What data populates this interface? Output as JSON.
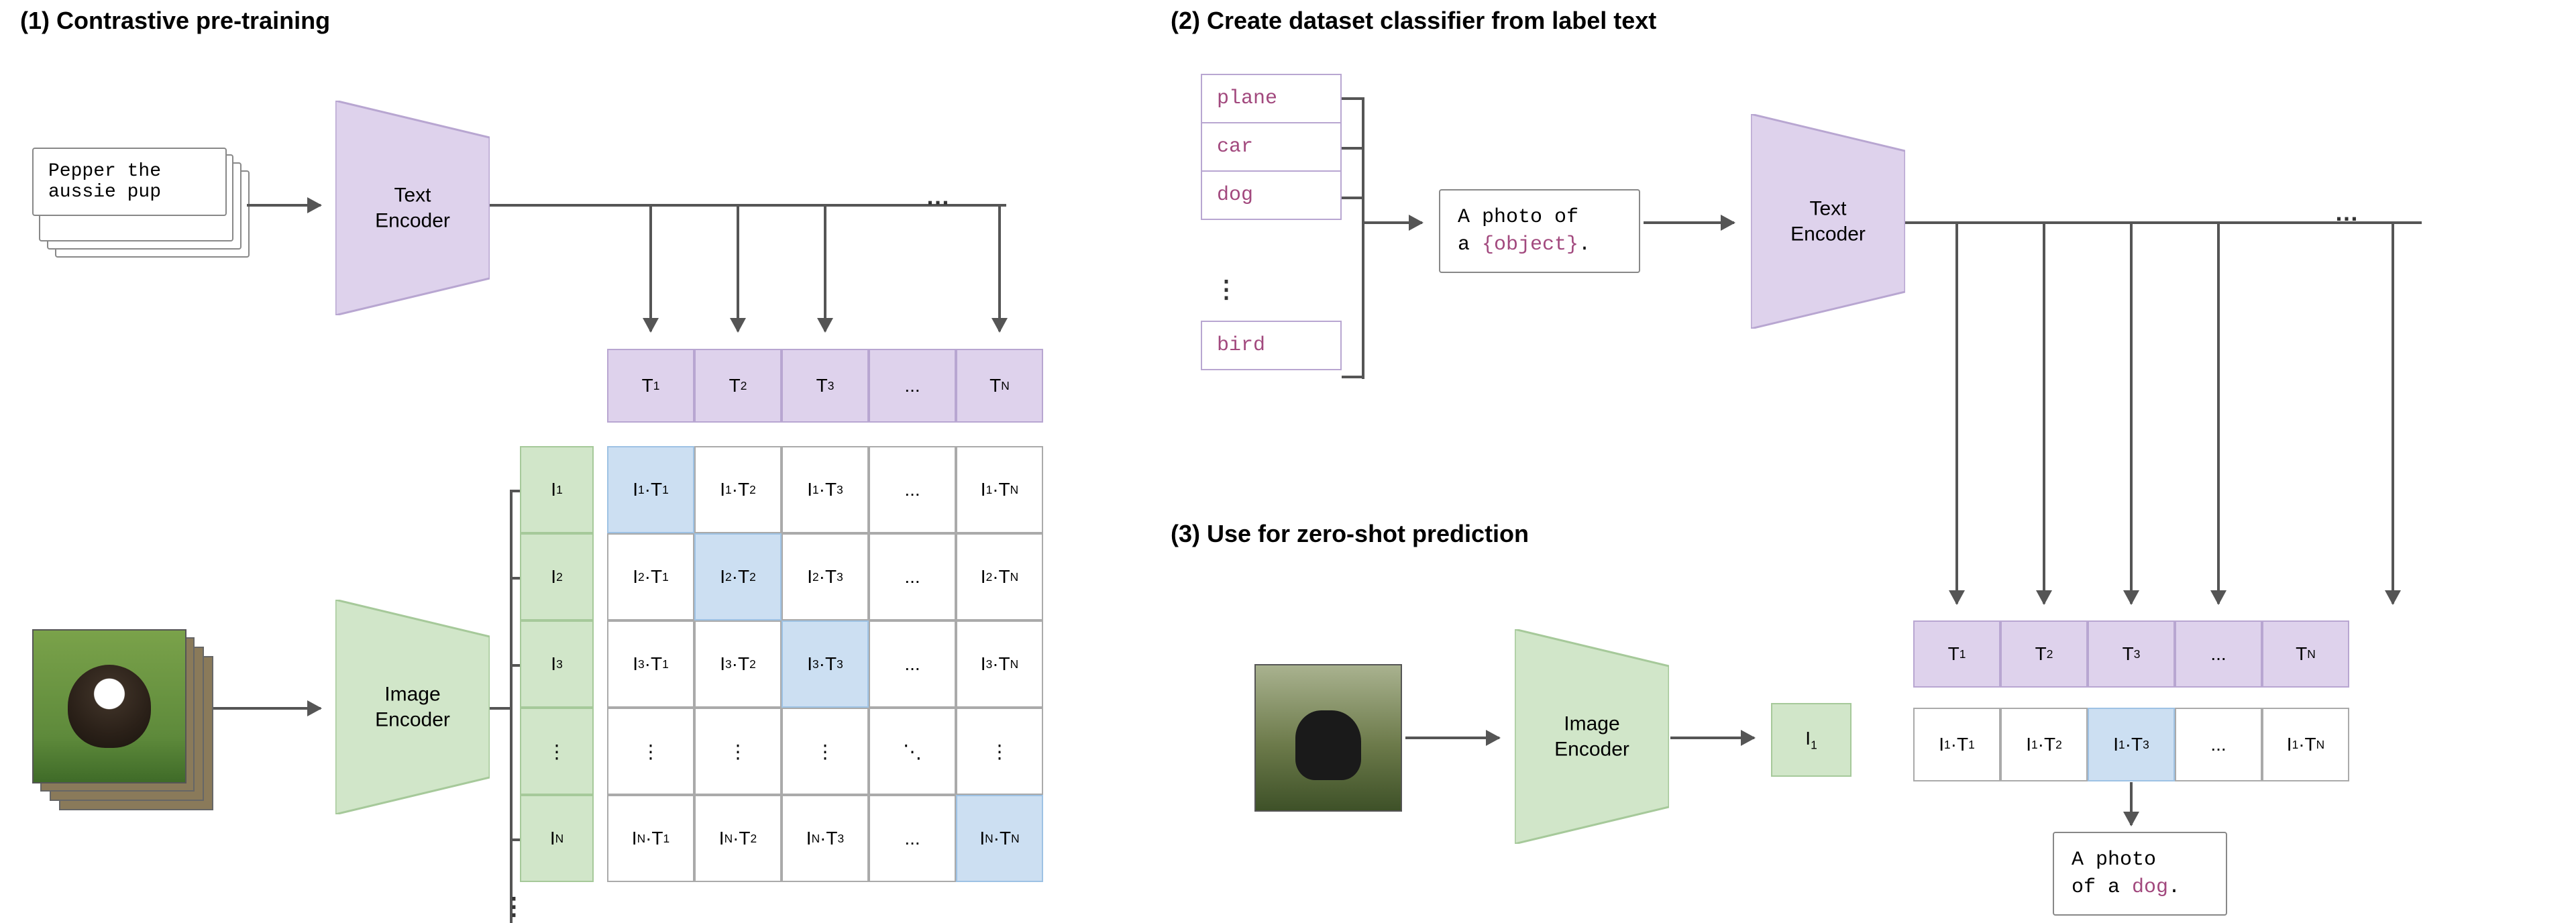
{
  "sections": {
    "s1": "(1) Contrastive pre-training",
    "s2": "(2) Create dataset classifier from label text",
    "s3": "(3) Use for zero-shot prediction"
  },
  "encoders": {
    "text": "Text\nEncoder",
    "image": "Image\nEncoder"
  },
  "caption_example": "Pepper the\naussie pup",
  "labels": {
    "items": [
      "plane",
      "car",
      "dog",
      "bird"
    ]
  },
  "prompt_template": {
    "prefix": "A photo of\na ",
    "slot": "{object}",
    "suffix": "."
  },
  "prediction_output": {
    "prefix": "A photo\nof a ",
    "word": "dog",
    "suffix": "."
  },
  "vectors": {
    "T": [
      "T₁",
      "T₂",
      "T₃",
      "...",
      "T_N"
    ],
    "I": [
      "I₁",
      "I₂",
      "I₃",
      "⋮",
      "I_N"
    ]
  },
  "matrix_left": {
    "rows": [
      [
        "I₁·T₁",
        "I₁·T₂",
        "I₁·T₃",
        "...",
        "I₁·T_N"
      ],
      [
        "I₂·T₁",
        "I₂·T₂",
        "I₂·T₃",
        "...",
        "I₂·T_N"
      ],
      [
        "I₃·T₁",
        "I₃·T₂",
        "I₃·T₃",
        "...",
        "I₃·T_N"
      ],
      [
        "⋮",
        "⋮",
        "⋮",
        "⋱",
        "⋮"
      ],
      [
        "I_N·T₁",
        "I_N·T₂",
        "I_N·T₃",
        "...",
        "I_N·T_N"
      ]
    ],
    "diag_highlight": [
      0,
      1,
      2,
      4
    ]
  },
  "right_I": "I₁",
  "right_row": [
    "I₁·T₁",
    "I₁·T₂",
    "I₁·T₃",
    "...",
    "I₁·T_N"
  ],
  "right_highlight_col": 2,
  "glyphs": {
    "dots_h": "…",
    "dots_v": "⋮"
  },
  "colors": {
    "purple_fill": "#ded2ec",
    "purple_stroke": "#b8a6d1",
    "green_fill": "#d1e6c9",
    "green_stroke": "#a6c99a",
    "blue_fill": "#ccdff2",
    "label_accent": "#a2497e"
  }
}
